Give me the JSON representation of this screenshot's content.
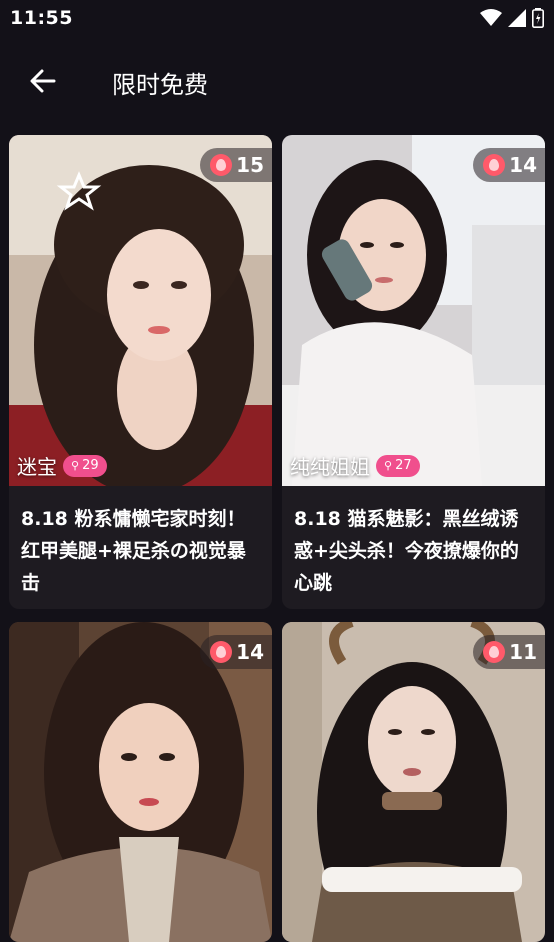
{
  "status": {
    "time": "11:55"
  },
  "header": {
    "title": "限时免费"
  },
  "cards": [
    {
      "name": "迷宝",
      "likes": "29",
      "views": "15",
      "title": "8.18 粉系慵懒宅家时刻！红甲美腿+裸足杀の视觉暴击"
    },
    {
      "name": "纯纯姐姐",
      "likes": "27",
      "views": "14",
      "title": "8.18 猫系魅影：黑丝绒诱惑+尖头杀！今夜撩爆你的心跳"
    },
    {
      "views": "14"
    },
    {
      "views": "11"
    }
  ],
  "colors": {
    "background": "#131118",
    "card": "#1e1b21",
    "pill": "#f04f8d",
    "flame": "#ff5a6a"
  }
}
